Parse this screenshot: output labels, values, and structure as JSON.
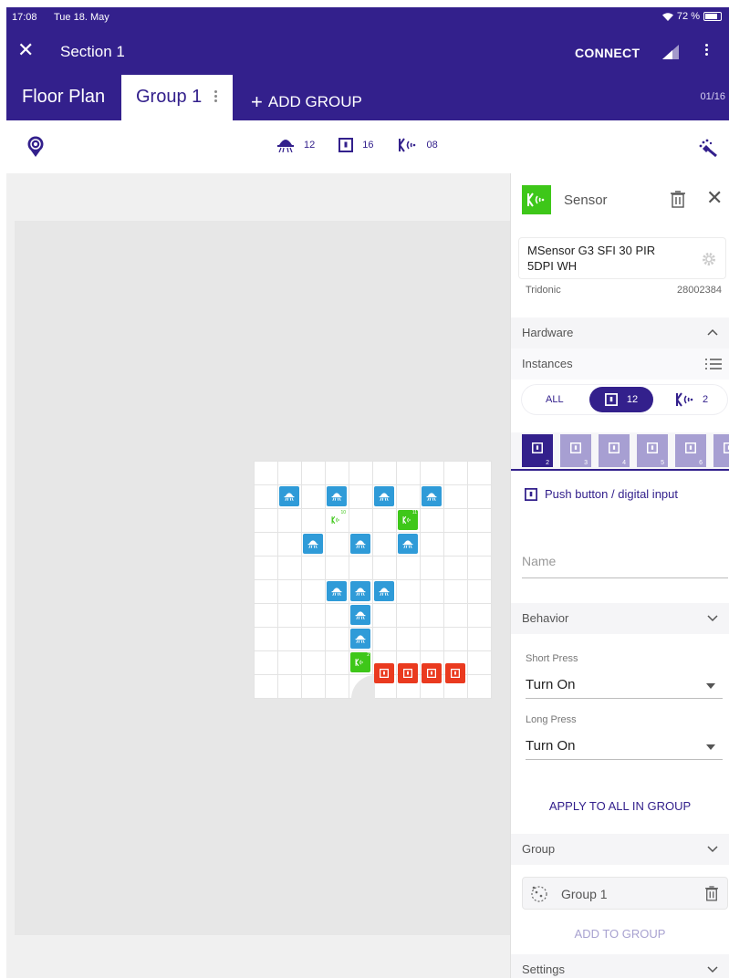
{
  "status_bar": {
    "time": "17:08",
    "date": "Tue 18. May",
    "battery": "72 %"
  },
  "toolbar": {
    "title": "Section 1",
    "connect_label": "CONNECT"
  },
  "tabs": {
    "floor_plan": "Floor Plan",
    "group": "Group 1",
    "add_group": "ADD GROUP",
    "page_counter": "01/16"
  },
  "counts": {
    "lights": "12",
    "buttons": "16",
    "sensors": "08"
  },
  "grid": {
    "tile_numbers": [
      "10",
      "11",
      "2"
    ]
  },
  "panel": {
    "title": "Sensor",
    "device_name": "MSensor G3 SFI 30 PIR 5DPI WH",
    "manufacturer": "Tridonic",
    "article_number": "28002384",
    "hardware_label": "Hardware",
    "instances_label": "Instances",
    "filter": {
      "all": "ALL",
      "buttons_count": "12",
      "sensors_count": "2"
    },
    "instance_numbers": [
      "2",
      "3",
      "4",
      "5",
      "6"
    ],
    "instance_type": "Push button / digital input",
    "name_placeholder": "Name",
    "behavior_label": "Behavior",
    "short_press_label": "Short Press",
    "short_press_value": "Turn On",
    "long_press_label": "Long Press",
    "long_press_value": "Turn On",
    "apply_label": "APPLY TO ALL IN GROUP",
    "group_label": "Group",
    "group_chip": "Group 1",
    "add_to_group": "ADD TO GROUP",
    "settings_label": "Settings"
  },
  "colors": {
    "primary": "#33208c",
    "light": "#2f9bd8",
    "sensor": "#3ec719",
    "button": "#ea3a1f"
  }
}
